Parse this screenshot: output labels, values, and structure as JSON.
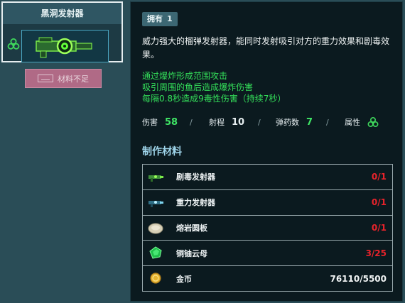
{
  "weapon": {
    "name": "黑洞发射器",
    "icon": "black-hole-launcher-icon",
    "side_icon": "biohazard-icon"
  },
  "craft_button": {
    "label": "材料不足",
    "key_icon": "spacebar-key-icon"
  },
  "owned": {
    "label": "拥有",
    "count": "1"
  },
  "description": "威力强大的榴弹发射器，能同时发射吸引对方的重力效果和剧毒效果。",
  "effects": [
    "通过爆炸形成范围攻击",
    "吸引周围的鱼后造成爆炸伤害",
    "每隔0.8秒造成9毒性伤害（持续7秒）"
  ],
  "stats": {
    "damage_label": "伤害",
    "damage_value": "58",
    "range_label": "射程",
    "range_value": "10",
    "ammo_label": "弹药数",
    "ammo_value": "7",
    "attribute_label": "属性",
    "attribute_icon": "biohazard-icon",
    "separator": "/"
  },
  "materials": {
    "title": "制作材料",
    "items": [
      {
        "name": "剧毒发射器",
        "count": "0/1",
        "icon": "toxic-launcher-icon",
        "sufficient": false
      },
      {
        "name": "重力发射器",
        "count": "0/1",
        "icon": "gravity-launcher-icon",
        "sufficient": false
      },
      {
        "name": "熔岩圆板",
        "count": "0/1",
        "icon": "lava-disc-icon",
        "sufficient": false
      },
      {
        "name": "铜铀云母",
        "count": "3/25",
        "icon": "torbernite-crystal-icon",
        "sufficient": false
      },
      {
        "name": "金币",
        "count": "76110/5500",
        "icon": "gold-coin-icon",
        "sufficient": true
      }
    ]
  },
  "colors": {
    "effect_green": "#34e05a",
    "insufficient_red": "#e8232b",
    "panel_bg": "#0b1a1f",
    "page_bg": "#2a4d57"
  }
}
